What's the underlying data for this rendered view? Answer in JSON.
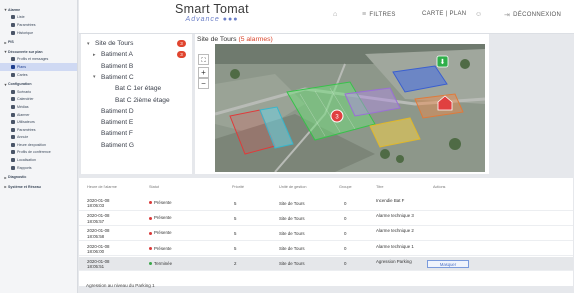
{
  "header": {
    "brand_line1": "Smart Tomat",
    "brand_line2": "Advance",
    "filters_label": "FILTRES",
    "map_plan_label": "CARTE | PLAN",
    "logout_label": "DÉCONNEXION"
  },
  "sidebar": {
    "items": [
      {
        "label": "Alarme",
        "kind": "head"
      },
      {
        "label": "Liste",
        "kind": "item"
      },
      {
        "label": "Paramètres",
        "kind": "item"
      },
      {
        "label": "Historique",
        "kind": "item"
      },
      {
        "label": "PIS",
        "kind": "head"
      },
      {
        "label": "Découverte sur plan",
        "kind": "head"
      },
      {
        "label": "Profils et messages",
        "kind": "item"
      },
      {
        "label": "Plans",
        "kind": "active"
      },
      {
        "label": "Cartes",
        "kind": "item"
      },
      {
        "label": "Configuration",
        "kind": "head"
      },
      {
        "label": "Scénario",
        "kind": "item"
      },
      {
        "label": "Calendrier",
        "kind": "item"
      },
      {
        "label": "Médias",
        "kind": "item"
      },
      {
        "label": "Alarmer",
        "kind": "item"
      },
      {
        "label": "Utilisateurs",
        "kind": "item"
      },
      {
        "label": "Paramètres",
        "kind": "item"
      },
      {
        "label": "Annuie",
        "kind": "item"
      },
      {
        "label": "Heure dexposition",
        "kind": "item"
      },
      {
        "label": "Profils de conférence",
        "kind": "item"
      },
      {
        "label": "Localisation",
        "kind": "item"
      },
      {
        "label": "Rapports",
        "kind": "item"
      },
      {
        "label": "Diagnostic",
        "kind": "head"
      },
      {
        "label": "Système et Réseau",
        "kind": "head"
      }
    ]
  },
  "tree": {
    "items": [
      {
        "label": "Site de Tours",
        "arrow": "▾",
        "badge": "3"
      },
      {
        "label": "Batiment A",
        "arrow": "▸",
        "badge": "3"
      },
      {
        "label": "Batiment B",
        "arrow": "",
        "badge": ""
      },
      {
        "label": "Batiment C",
        "arrow": "▾",
        "badge": ""
      },
      {
        "label": "Bat C 1er étage",
        "arrow": "",
        "badge": ""
      },
      {
        "label": "Bat C 2ième étage",
        "arrow": "",
        "badge": ""
      },
      {
        "label": "Batiment D",
        "arrow": "",
        "badge": ""
      },
      {
        "label": "Batiment E",
        "arrow": "",
        "badge": ""
      },
      {
        "label": "Batiment F",
        "arrow": "",
        "badge": ""
      },
      {
        "label": "Batiment G",
        "arrow": "",
        "badge": ""
      }
    ]
  },
  "map": {
    "title": "Site de Tours",
    "alarm_count": "(5 alarmes)",
    "marker_count": "3",
    "zoom_in": "+",
    "zoom_out": "−",
    "fit": "⛶"
  },
  "table": {
    "headers": [
      "Heure de l'alarme",
      "Statut",
      "Priorité",
      "Unité de gestion",
      "Groupe",
      "Titre",
      "Actions"
    ],
    "rows": [
      {
        "time": "2020-01-08 18:05:03",
        "status": "Présente",
        "status_color": "#d93a3a",
        "priority": "5",
        "unit": "Site de Tours",
        "group": "0",
        "title": "Incendie Bat F",
        "action": ""
      },
      {
        "time": "2020-01-08 18:05:57",
        "status": "Présente",
        "status_color": "#d93a3a",
        "priority": "5",
        "unit": "Site de Tours",
        "group": "0",
        "title": "Alarme technique 3",
        "action": ""
      },
      {
        "time": "2020-01-08 18:05:58",
        "status": "Présente",
        "status_color": "#d93a3a",
        "priority": "5",
        "unit": "Site de Tours",
        "group": "0",
        "title": "Alarme technique 2",
        "action": ""
      },
      {
        "time": "2020-01-08 18:06:00",
        "status": "Présente",
        "status_color": "#d93a3a",
        "priority": "5",
        "unit": "Site de Tours",
        "group": "0",
        "title": "Alarme technique 1",
        "action": ""
      },
      {
        "time": "2020-01-08 18:05:51",
        "status": "Terminée",
        "status_color": "#3aa64a",
        "priority": "2",
        "unit": "Site de Tours",
        "group": "0",
        "title": "Agression Parking",
        "action": "Masquer"
      }
    ],
    "footer_text": "Agression au niveau du Parking 1"
  }
}
